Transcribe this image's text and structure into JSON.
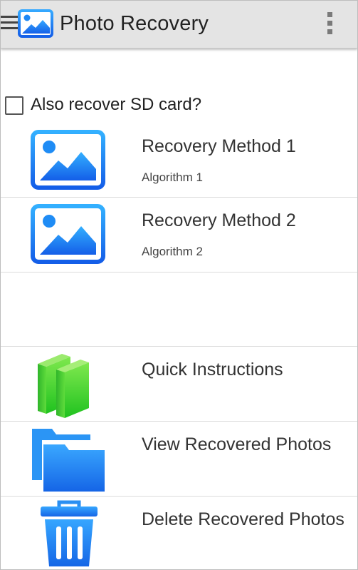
{
  "app_bar": {
    "title": "Photo Recovery",
    "menu_icon": "hamburger-menu-icon",
    "logo_icon": "photo-icon",
    "overflow_icon": "more-vertical-icon"
  },
  "sd_option": {
    "label": "Also recover SD card?",
    "checked": false
  },
  "recovery_methods": [
    {
      "title": "Recovery Method 1",
      "subtitle": "Algorithm 1",
      "icon": "photo-icon"
    },
    {
      "title": "Recovery Method 2",
      "subtitle": "Algorithm 2",
      "icon": "photo-icon"
    }
  ],
  "actions": [
    {
      "title": "Quick Instructions",
      "icon": "books-icon"
    },
    {
      "title": "View Recovered Photos",
      "icon": "folders-icon"
    },
    {
      "title": "Delete Recovered Photos",
      "icon": "trash-icon"
    }
  ],
  "colors": {
    "app_bar": "#e4e4e4",
    "photo_icon_blue": "#1e7cf0",
    "books_green": "#4cd836",
    "folder_blue": "#1a8cf0",
    "trash_blue": "#1f8ff2",
    "divider": "#dcdcdc"
  }
}
